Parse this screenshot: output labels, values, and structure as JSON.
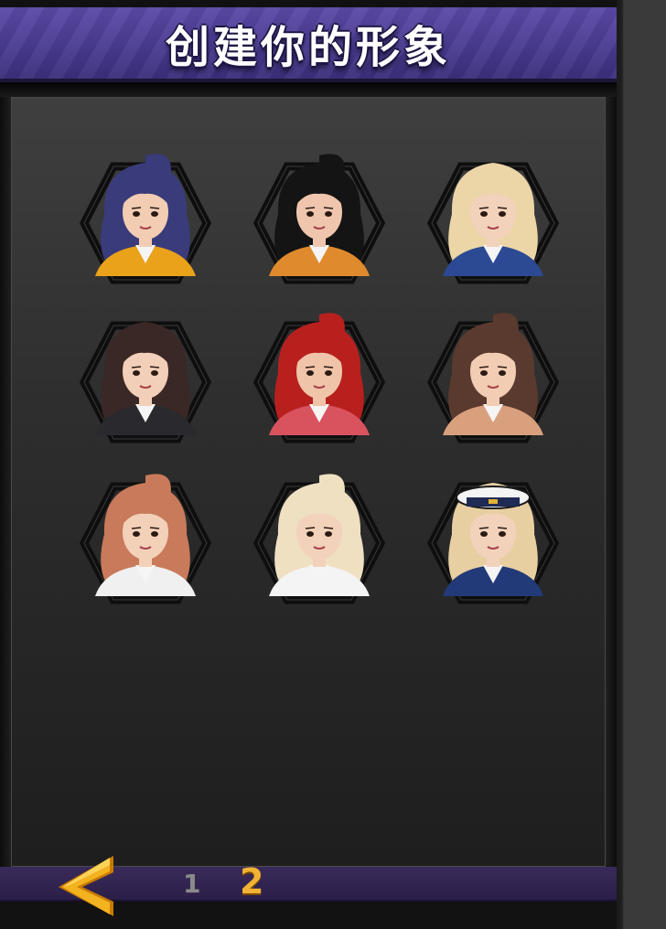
{
  "header": {
    "title": "创建你的形象"
  },
  "avatars": [
    {
      "name": "avatar-1",
      "hair": "#3a3b7a",
      "outfit": "#e9a21a",
      "skin": "#f2cdb3",
      "ponytail": true
    },
    {
      "name": "avatar-2",
      "hair": "#141414",
      "outfit": "#e08a2e",
      "skin": "#efc6ad",
      "ponytail": true
    },
    {
      "name": "avatar-3",
      "hair": "#ecd6a8",
      "outfit": "#2b4a93",
      "skin": "#f3d2bb",
      "ponytail": false
    },
    {
      "name": "avatar-4",
      "hair": "#3a2826",
      "outfit": "#2a2a2e",
      "skin": "#f2cfb8",
      "ponytail": false
    },
    {
      "name": "avatar-5",
      "hair": "#b8201e",
      "outfit": "#d9535f",
      "skin": "#f0c4a8",
      "ponytail": true
    },
    {
      "name": "avatar-6",
      "hair": "#5a3a2e",
      "outfit": "#d9a07e",
      "skin": "#f2cdb3",
      "ponytail": true
    },
    {
      "name": "avatar-7",
      "hair": "#c87a5a",
      "outfit": "#f0f0f0",
      "skin": "#f3d0b8",
      "ponytail": true
    },
    {
      "name": "avatar-8",
      "hair": "#efe0c2",
      "outfit": "#f4f4f4",
      "skin": "#f3d2bb",
      "ponytail": true
    },
    {
      "name": "avatar-9",
      "hair": "#e8cfa2",
      "outfit": "#233a78",
      "skin": "#f3d2bb",
      "ponytail": false,
      "hat": true
    }
  ],
  "pagination": {
    "page_1": "1",
    "page_2": "2",
    "current": 2
  },
  "colors": {
    "title_bar": "#4a3b92",
    "accent": "#f2b233",
    "hex_frame": "#0e0e0e"
  },
  "icons": {
    "back": "chevron-left-icon"
  }
}
